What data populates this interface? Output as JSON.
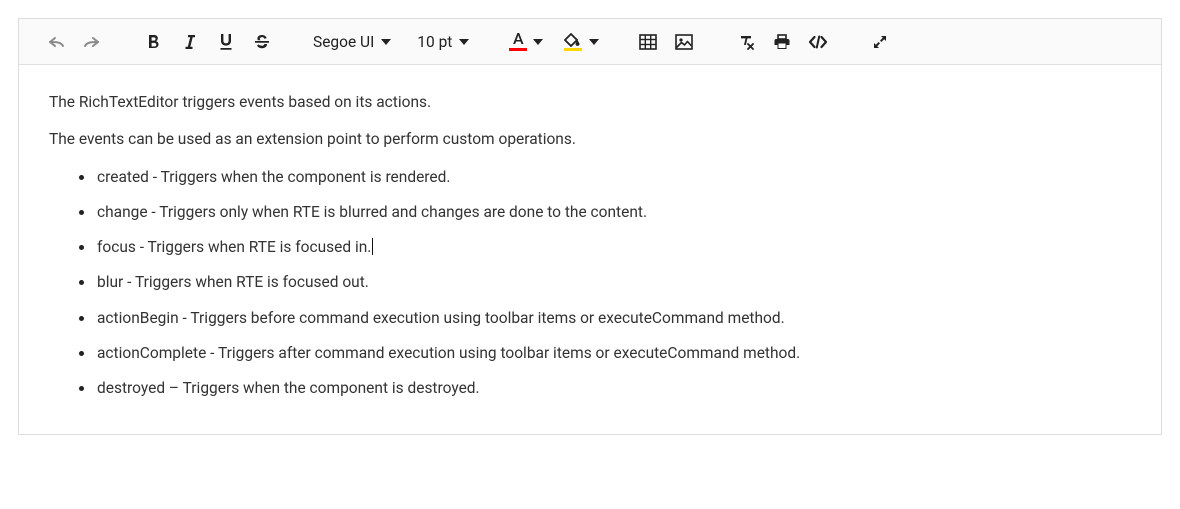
{
  "toolbar": {
    "font_name": "Segoe UI",
    "font_size": "10 pt",
    "font_color": "#ff0000",
    "bg_color": "#ffd600"
  },
  "content": {
    "p1": "The RichTextEditor triggers events based on its actions.",
    "p2": "The events can be used as an extension point to perform custom operations.",
    "items": [
      "created - Triggers when the component is rendered.",
      "change - Triggers only when RTE is blurred and changes are done to the content.",
      "focus - Triggers when RTE is focused in.",
      "blur - Triggers when RTE is focused out.",
      "actionBegin - Triggers before command execution using toolbar items or executeCommand method.",
      "actionComplete - Triggers after command execution using toolbar items or executeCommand method.",
      "destroyed – Triggers when the component is destroyed."
    ],
    "cursor_after_item_index": 2
  }
}
